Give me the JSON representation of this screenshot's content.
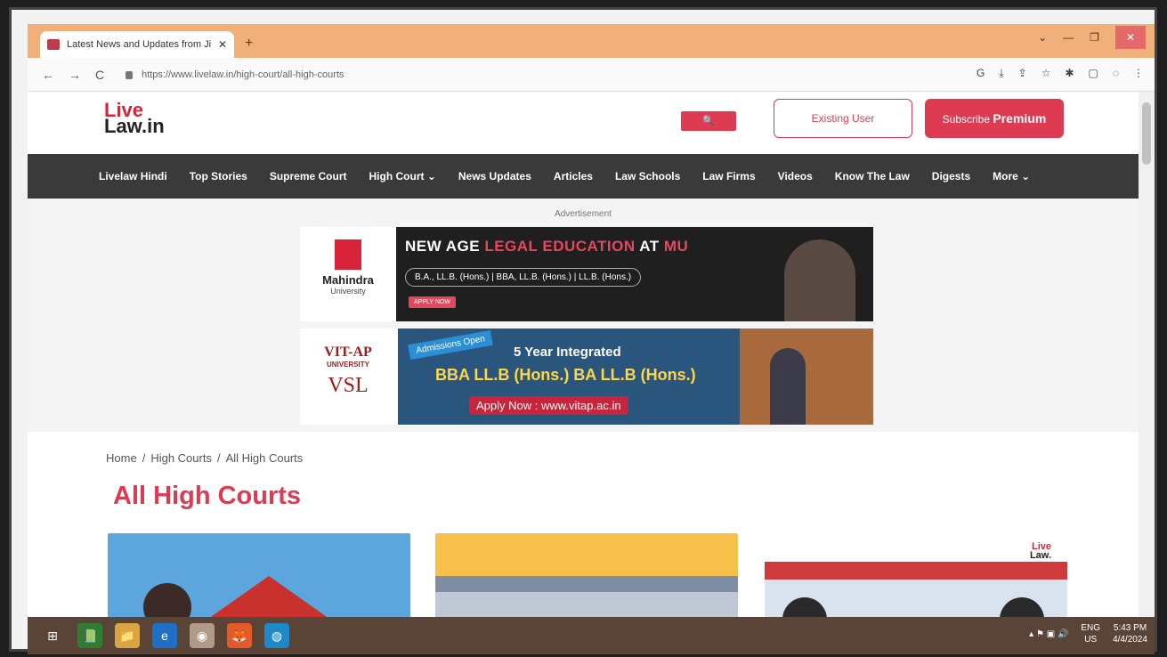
{
  "browser": {
    "tab_title": "Latest News and Updates from Ji",
    "tab_close": "✕",
    "new_tab": "+",
    "url": "https://www.livelaw.in/high-court/all-high-courts",
    "window_controls": {
      "minimize": "—",
      "maximize": "❐",
      "close": "✕",
      "chevron": "⌄"
    },
    "nav": {
      "back": "←",
      "forward": "→",
      "reload": "C"
    },
    "extensions": [
      "G",
      "⤓",
      "⇪",
      "☆",
      "✱",
      "▢",
      "◌",
      "⋮"
    ]
  },
  "site": {
    "logo_line1": "Live",
    "logo_line2": "Law.in",
    "search_icon": "🔍",
    "existing_user": "Existing User",
    "subscribe_prefix": "Subscribe",
    "subscribe_bold": "Premium",
    "nav": [
      "Livelaw Hindi",
      "Top Stories",
      "Supreme Court",
      "High Court ⌄",
      "News Updates",
      "Articles",
      "Law Schools",
      "Law Firms",
      "Videos",
      "Know The Law",
      "Digests",
      "More ⌄"
    ],
    "accent": "#de3a52"
  },
  "ads": {
    "label": "Advertisement",
    "ad1": {
      "brand": "Mahindra",
      "brand_sub": "University",
      "headline_a": "NEW AGE",
      "headline_b": "LEGAL EDUCATION",
      "headline_c": "AT",
      "headline_d": "MU",
      "courses": "B.A., LL.B. (Hons.) | BBA, LL.B. (Hons.) | LL.B. (Hons.)",
      "apply": "APPLY NOW"
    },
    "ad2": {
      "brand": "VIT-AP",
      "brand_sub": "UNIVERSITY",
      "brand2": "VSL",
      "badge": "Admissions Open",
      "title": "5 Year Integrated",
      "programs": "BBA LL.B (Hons.)    BA LL.B (Hons.)",
      "apply": "Apply Now : www.vitap.ac.in"
    }
  },
  "page": {
    "breadcrumb": [
      "Home",
      "High Courts",
      "All High Courts"
    ],
    "breadcrumb_sep": "/",
    "title": "All High Courts",
    "card3_watermark_1": "Live",
    "card3_watermark_2": "Law."
  },
  "taskbar": {
    "start": "⊞",
    "apps": [
      "📗",
      "📁",
      "e",
      "◉",
      "🦊",
      "◍"
    ],
    "tray_icons": "▴ ⚑ ▣ 🔊",
    "lang_1": "ENG",
    "lang_2": "US",
    "time": "5:43 PM",
    "date": "4/4/2024"
  }
}
